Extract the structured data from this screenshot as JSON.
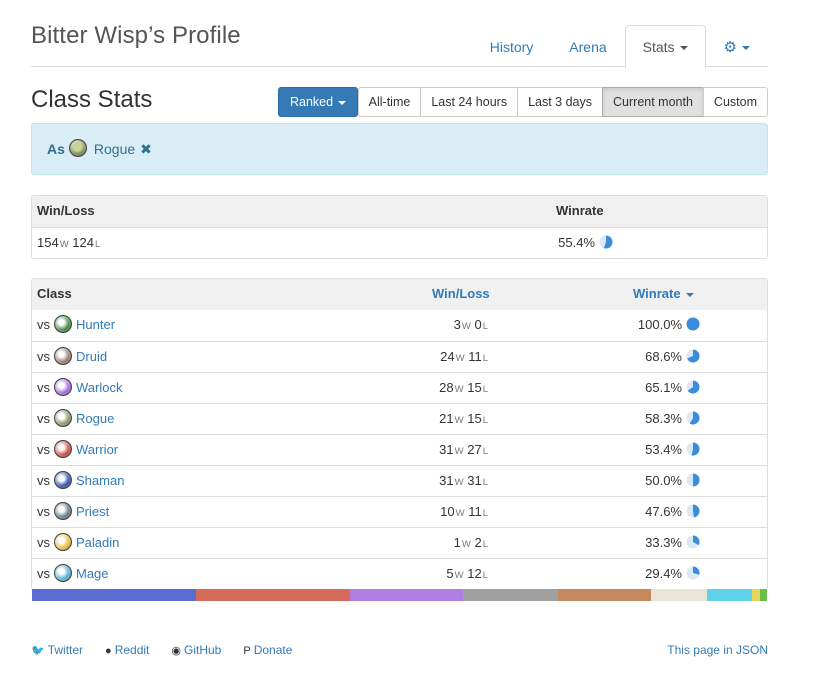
{
  "header": {
    "title": "Bitter Wisp’s Profile",
    "tabs": [
      {
        "label": "History",
        "active": false
      },
      {
        "label": "Arena",
        "active": false
      },
      {
        "label": "Stats",
        "active": true
      }
    ],
    "settings_icon": "gear-icon"
  },
  "section": {
    "title": "Class Stats",
    "mode_button": "Ranked",
    "time_filters": [
      {
        "label": "All-time",
        "active": false
      },
      {
        "label": "Last 24 hours",
        "active": false
      },
      {
        "label": "Last 3 days",
        "active": false
      },
      {
        "label": "Current month",
        "active": true
      },
      {
        "label": "Custom",
        "active": false
      }
    ]
  },
  "filter_alert": {
    "prefix": "As",
    "class_name": "Rogue",
    "remove_icon": "close-icon"
  },
  "summary": {
    "headers": {
      "winloss": "Win/Loss",
      "winrate": "Winrate"
    },
    "wins": "154",
    "losses": "124",
    "win_suffix": "W",
    "loss_suffix": "L",
    "winrate": "55.4%",
    "winrate_fraction": 0.554
  },
  "classes": {
    "headers": {
      "class": "Class",
      "winloss": "Win/Loss",
      "winrate": "Winrate"
    },
    "vs_label": "vs",
    "rows": [
      {
        "name": "Hunter",
        "wins": "3",
        "losses": "0",
        "winrate": "100.0%",
        "fraction": 1.0,
        "color": "#2e7d32"
      },
      {
        "name": "Druid",
        "wins": "24",
        "losses": "11",
        "winrate": "68.6%",
        "fraction": 0.686,
        "color": "#8d6e63"
      },
      {
        "name": "Warlock",
        "wins": "28",
        "losses": "15",
        "winrate": "65.1%",
        "fraction": 0.651,
        "color": "#9c5bd6"
      },
      {
        "name": "Rogue",
        "wins": "21",
        "losses": "15",
        "winrate": "58.3%",
        "fraction": 0.583,
        "color": "#7d8b5a"
      },
      {
        "name": "Warrior",
        "wins": "31",
        "losses": "27",
        "winrate": "53.4%",
        "fraction": 0.534,
        "color": "#c0392b"
      },
      {
        "name": "Shaman",
        "wins": "31",
        "losses": "31",
        "winrate": "50.0%",
        "fraction": 0.5,
        "color": "#1a3f9e"
      },
      {
        "name": "Priest",
        "wins": "10",
        "losses": "11",
        "winrate": "47.6%",
        "fraction": 0.476,
        "color": "#546e7a"
      },
      {
        "name": "Paladin",
        "wins": "1",
        "losses": "2",
        "winrate": "33.3%",
        "fraction": 0.333,
        "color": "#e6b422"
      },
      {
        "name": "Mage",
        "wins": "5",
        "losses": "12",
        "winrate": "29.4%",
        "fraction": 0.294,
        "color": "#3fa9c9"
      }
    ]
  },
  "distribution_bar": [
    {
      "class": "shaman",
      "color": "#5b6bd1",
      "share": 0.223
    },
    {
      "class": "warrior",
      "color": "#d46a5a",
      "share": 0.209
    },
    {
      "class": "warlock",
      "color": "#b07ee0",
      "share": 0.155
    },
    {
      "class": "rogue",
      "color": "#a0a0a0",
      "share": 0.129
    },
    {
      "class": "druid",
      "color": "#c4895c",
      "share": 0.126
    },
    {
      "class": "priest",
      "color": "#e8e4d8",
      "share": 0.076
    },
    {
      "class": "mage",
      "color": "#5fd2ea",
      "share": 0.061
    },
    {
      "class": "paladin",
      "color": "#e8d45a",
      "share": 0.011
    },
    {
      "class": "hunter",
      "color": "#6cbf4a",
      "share": 0.01
    }
  ],
  "footer": {
    "links": [
      {
        "label": "Twitter",
        "icon": "twitter-icon"
      },
      {
        "label": "Reddit",
        "icon": "reddit-icon"
      },
      {
        "label": "GitHub",
        "icon": "github-icon"
      },
      {
        "label": "Donate",
        "icon": "paypal-icon"
      }
    ],
    "json_link": "This page in JSON"
  }
}
